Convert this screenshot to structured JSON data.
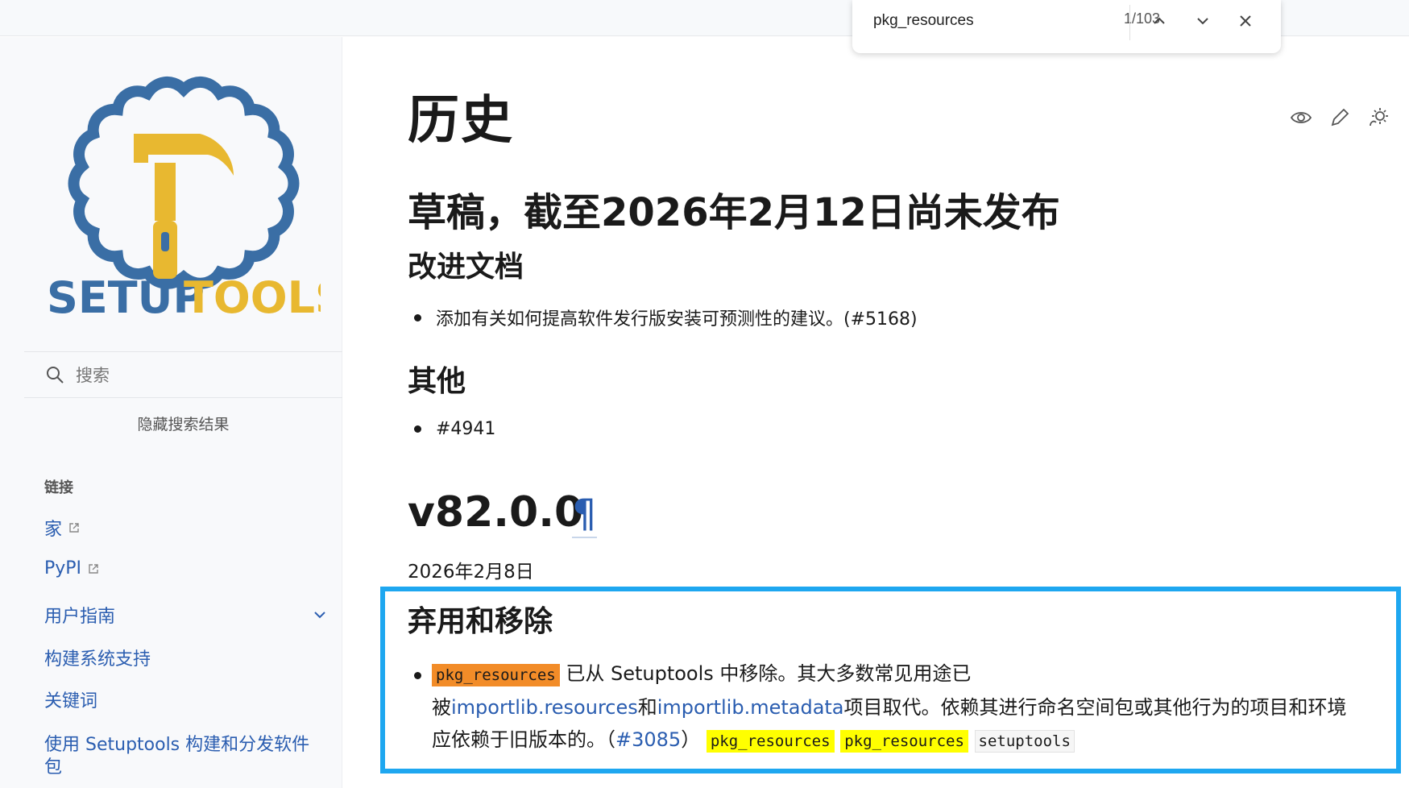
{
  "find": {
    "query": "pkg_resources",
    "count": "1/103"
  },
  "sidebar": {
    "logo_text_a": "SETUP",
    "logo_text_b": "TOOLS",
    "search_placeholder": "搜索",
    "hide_results": "隐藏搜索结果",
    "caption": "链接",
    "items": [
      {
        "label": "家"
      },
      {
        "label": "PyPI"
      },
      {
        "label": "用户指南"
      },
      {
        "label": "构建系统支持"
      },
      {
        "label": "关键词"
      },
      {
        "label": "使用 Setuptools 构建和分发软件"
      },
      {
        "label": "包"
      }
    ]
  },
  "main": {
    "title": "历史",
    "draft_heading": "草稿，截至2026年2月12日尚未发布",
    "section1": "改进文档",
    "bullet1": "添加有关如何提高软件发行版安装可预测性的建议。(#5168)",
    "section2": "其他",
    "bullet2": "#4941",
    "version": "v82.0.0",
    "pilcrow": "¶",
    "date": "2026年2月8日",
    "section3": "弃用和移除",
    "para": {
      "code1": "pkg_resources",
      "t1": "已从 Setuptools 中移除。其大多数常见用途已",
      "t2": "被",
      "link1": "importlib.resources",
      "t3": "和",
      "link2": "importlib.metadata",
      "t4": "项目取代。依赖其进行命名空间包或其他行为的项目和环境",
      "t5": "应依赖于旧版本的。（",
      "link3": "#3085",
      "t6": "）",
      "code2": "pkg_resources",
      "code3": "pkg_resources",
      "code4": "setuptools"
    }
  },
  "colors": {
    "accent": "#2a5db0",
    "highlight_border": "#1ea7f0",
    "match_current": "#f28c28",
    "match_other": "#ffff00",
    "logo_blue": "#3a6ea5",
    "logo_yellow": "#e8b830"
  },
  "icons": [
    "up-arrow-icon",
    "down-arrow-icon",
    "close-icon",
    "search-icon",
    "external-link-icon",
    "chevron-down-icon",
    "eye-icon",
    "edit-icon",
    "theme-toggle-icon"
  ]
}
